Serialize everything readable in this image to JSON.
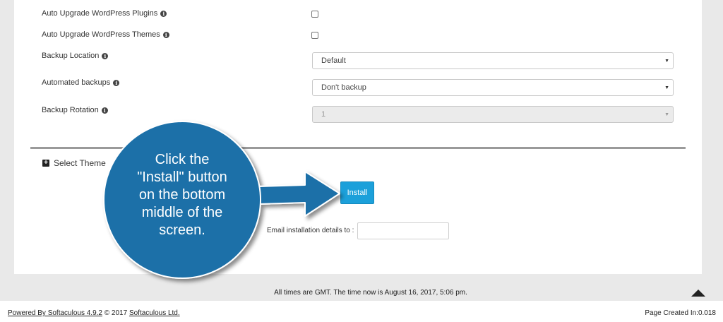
{
  "options": {
    "auto_upgrade_plugins": {
      "label": "Auto Upgrade WordPress Plugins",
      "checked": false
    },
    "auto_upgrade_themes": {
      "label": "Auto Upgrade WordPress Themes",
      "checked": false
    },
    "backup_location": {
      "label": "Backup Location",
      "value": "Default"
    },
    "automated_backups": {
      "label": "Automated backups",
      "value": "Don't backup"
    },
    "backup_rotation": {
      "label": "Backup Rotation",
      "value": "1",
      "disabled": true
    }
  },
  "select_theme": {
    "label": "Select Theme"
  },
  "install": {
    "label": "Install"
  },
  "email": {
    "label": "Email installation details to :",
    "value": ""
  },
  "callout": {
    "lines": [
      "Click the",
      "\"Install\" button",
      "on the bottom",
      "middle of the",
      "screen."
    ]
  },
  "gmt_notice": "All times are GMT. The time now is August 16, 2017, 5:06 pm.",
  "footer": {
    "powered_link": "Powered By Softaculous 4.9.2",
    "copyright": " © 2017 ",
    "company_link": "Softaculous Ltd.",
    "page_created": "Page Created In:0.018"
  },
  "colors": {
    "callout_fill": "#1a6fa8",
    "install_button": "#1ca0da"
  }
}
